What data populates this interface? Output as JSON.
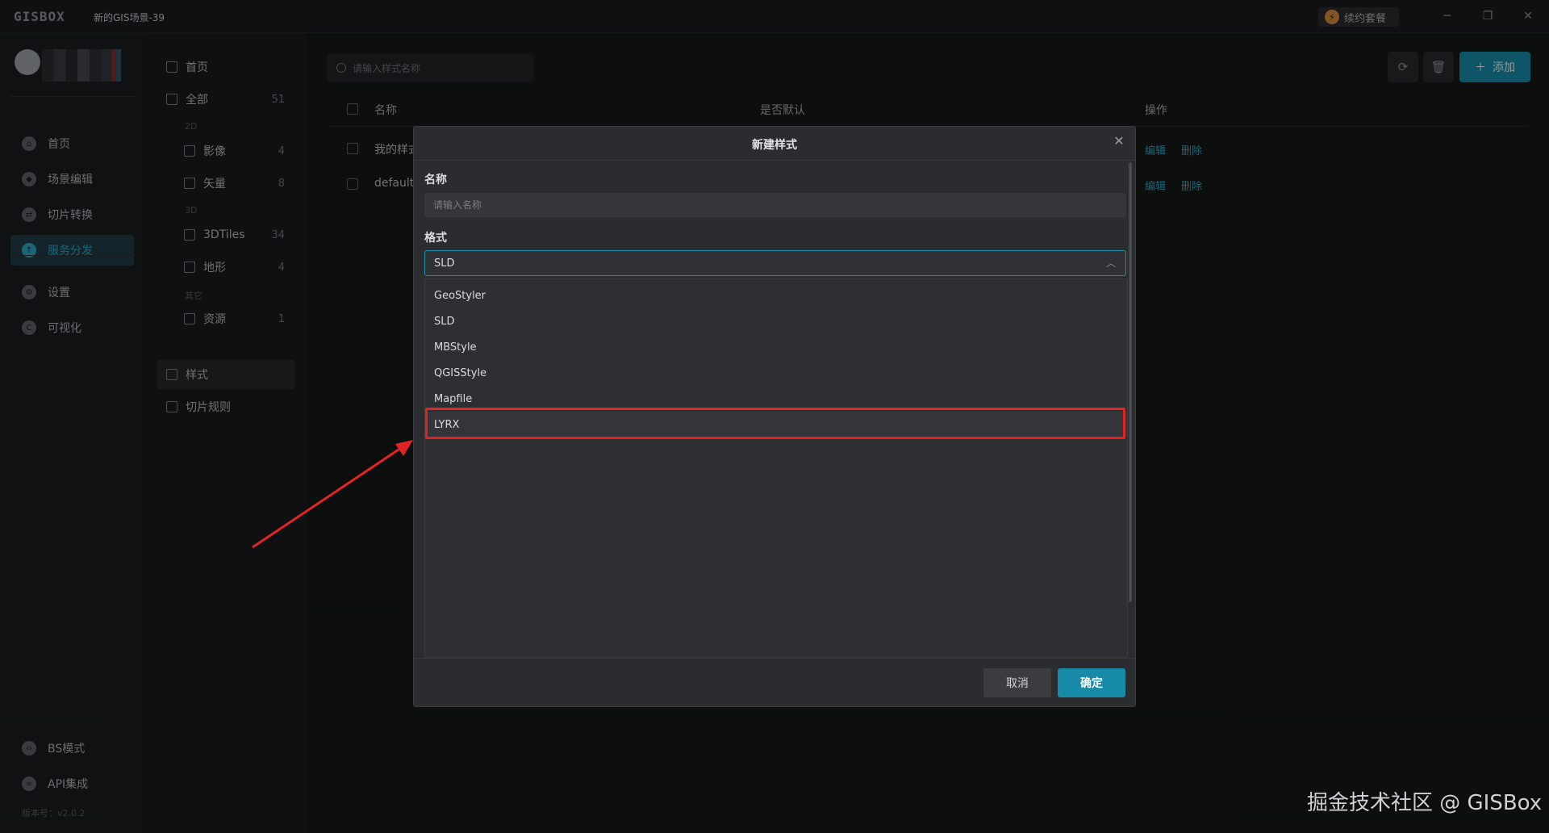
{
  "titlebar": {
    "logo": "GISBOX",
    "scene": "新的GIS场景-39",
    "renew": "续约套餐"
  },
  "window_controls": {
    "minimize": "─",
    "restore": "❐",
    "close": "✕"
  },
  "leftnav": {
    "items": [
      {
        "label": "首页",
        "icon": "home-icon"
      },
      {
        "label": "场景编辑",
        "icon": "cube-icon"
      },
      {
        "label": "切片转换",
        "icon": "convert-icon"
      },
      {
        "label": "服务分发",
        "icon": "upload-icon",
        "active": true
      },
      {
        "label": "设置",
        "icon": "gear-icon"
      },
      {
        "label": "可视化",
        "icon": "chart-icon"
      }
    ],
    "bottom": [
      {
        "label": "BS模式",
        "icon": "code-icon"
      },
      {
        "label": "API集成",
        "icon": "link-icon"
      }
    ],
    "version": "版本号：v2.0.2"
  },
  "catpanel": {
    "home": "首页",
    "all": {
      "label": "全部",
      "count": "51"
    },
    "group_2d": "2D",
    "image": {
      "label": "影像",
      "count": "4"
    },
    "vector": {
      "label": "矢量",
      "count": "8"
    },
    "group_3d": "3D",
    "tiles3d": {
      "label": "3DTiles",
      "count": "34"
    },
    "terrain": {
      "label": "地形",
      "count": "4"
    },
    "group_other": "其它",
    "resource": {
      "label": "资源",
      "count": "1"
    },
    "style": "样式",
    "tile_rule": "切片规则"
  },
  "main": {
    "search_placeholder": "请输入样式名称",
    "add_label": "添加",
    "columns": {
      "name": "名称",
      "default": "是否默认",
      "ops": "操作"
    },
    "rows": [
      {
        "name": "我的样式",
        "edit": "编辑",
        "delete": "删除"
      },
      {
        "name": "default",
        "edit": "编辑",
        "delete": "删除"
      }
    ]
  },
  "modal": {
    "title": "新建样式",
    "name_label": "名称",
    "name_placeholder": "请输入名称",
    "format_label": "格式",
    "format_value": "SLD",
    "options": [
      "GeoStyler",
      "SLD",
      "MBStyle",
      "QGISStyle",
      "Mapfile",
      "LYRX"
    ],
    "cancel": "取消",
    "ok": "确定"
  },
  "colors": {
    "accent": "#168aa6",
    "highlight": "#e02424",
    "background": "#161718"
  },
  "watermark": "掘金技术社区 @ GISBox"
}
